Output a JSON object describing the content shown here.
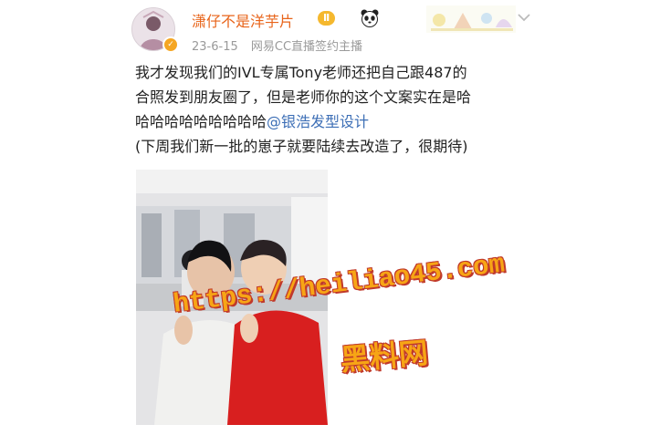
{
  "post": {
    "author": "潇仔不是洋芋片",
    "level_badge": "Ⅱ",
    "date": "23-6-15",
    "source": "网易CC直播签约主播",
    "text_line1": "我才发现我们的IVL专属Tony老师还把自己跟487的",
    "text_line2": "合照发到朋友圈了，但是老师你的这个文案实在是哈",
    "text_line3_prefix": "哈哈哈哈哈哈哈哈哈",
    "mention": "@银浩发型设计",
    "text_line4": "(下周我们新一批的崽子就要陆续去改造了，很期待)"
  },
  "watermark": {
    "url": "https://heiliao45.com",
    "name": "黑料网"
  },
  "colors": {
    "author_name": "#e8641a",
    "mention": "#3d6fb6",
    "meta_gray": "#9a9a9a",
    "watermark_fill": "#f7a515",
    "watermark_outline": "#c0392b"
  },
  "icons": [
    "avatar",
    "verified-badge-icon",
    "level-badge",
    "panda-emoji-icon",
    "header-decoration-image",
    "chevron-down-icon"
  ]
}
